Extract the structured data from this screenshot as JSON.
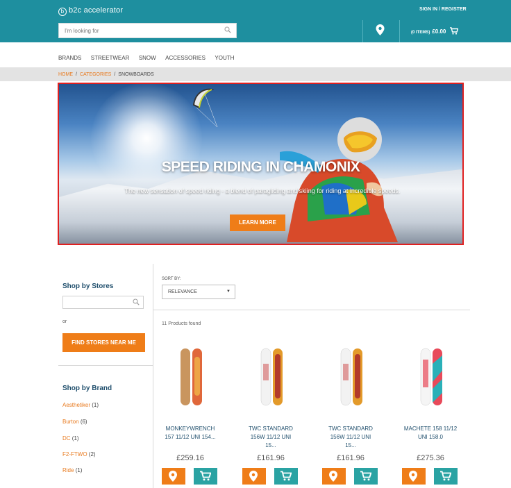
{
  "header": {
    "logo_mark": "b",
    "logo_text": "b2c accelerator",
    "signin": "SIGN IN / REGISTER",
    "search_placeholder": "I'm looking for",
    "cart_items": "(0 ITEMS)",
    "cart_total": "£0.00"
  },
  "nav": [
    "BRANDS",
    "STREETWEAR",
    "SNOW",
    "ACCESSORIES",
    "YOUTH"
  ],
  "breadcrumb": {
    "home": "HOME",
    "categories": "CATEGORIES",
    "current": "SNOWBOARDS",
    "separator": "/"
  },
  "hero": {
    "title": "SPEED RIDING IN CHAMONIX",
    "subtitle": "The new sensation of speed riding - a blend of paragliding and skiing for riding at incredible speeds.",
    "button": "LEARN MORE"
  },
  "sidebar": {
    "stores_title": "Shop by Stores",
    "or": "or",
    "find_button": "FIND STORES NEAR ME",
    "brand_title": "Shop by Brand",
    "brands": [
      {
        "name": "Aesthetiker",
        "count": "(1)"
      },
      {
        "name": "Burton",
        "count": "(6)"
      },
      {
        "name": "DC",
        "count": "(1)"
      },
      {
        "name": "F2-FTWO",
        "count": "(2)"
      },
      {
        "name": "Ride",
        "count": "(1)"
      }
    ]
  },
  "results": {
    "sort_label": "SORT BY:",
    "sort_value": "RELEVANCE",
    "found": "11 Products found"
  },
  "products": [
    {
      "name_line1": "MONKEYWRENCH",
      "name_line2": "157 11/12 UNI 154...",
      "name_line3": "",
      "price": "£259.16",
      "colors": [
        "#c9955f",
        "#e0673a"
      ]
    },
    {
      "name_line1": "TWC STANDARD",
      "name_line2": "156W 11/12 UNI",
      "name_line3": "15...",
      "price": "£161.96",
      "colors": [
        "#f2f2f2",
        "#e39a2a"
      ]
    },
    {
      "name_line1": "TWC STANDARD",
      "name_line2": "156W 11/12 UNI",
      "name_line3": "15...",
      "price": "£161.96",
      "colors": [
        "#f2f2f2",
        "#e39a2a"
      ]
    },
    {
      "name_line1": "MACHETE 158 11/12",
      "name_line2": "UNI 158.0",
      "name_line3": "",
      "price": "£275.36",
      "colors": [
        "#e84a5a",
        "#2ab0b8"
      ]
    }
  ],
  "colors": {
    "teal": "#1e8f9f",
    "orange": "#ef7d18",
    "cart_teal": "#2aa3a3",
    "highlight": "#e02020"
  },
  "icons": {
    "search": "search-icon",
    "location": "map-pin-icon",
    "cart": "cart-icon"
  }
}
